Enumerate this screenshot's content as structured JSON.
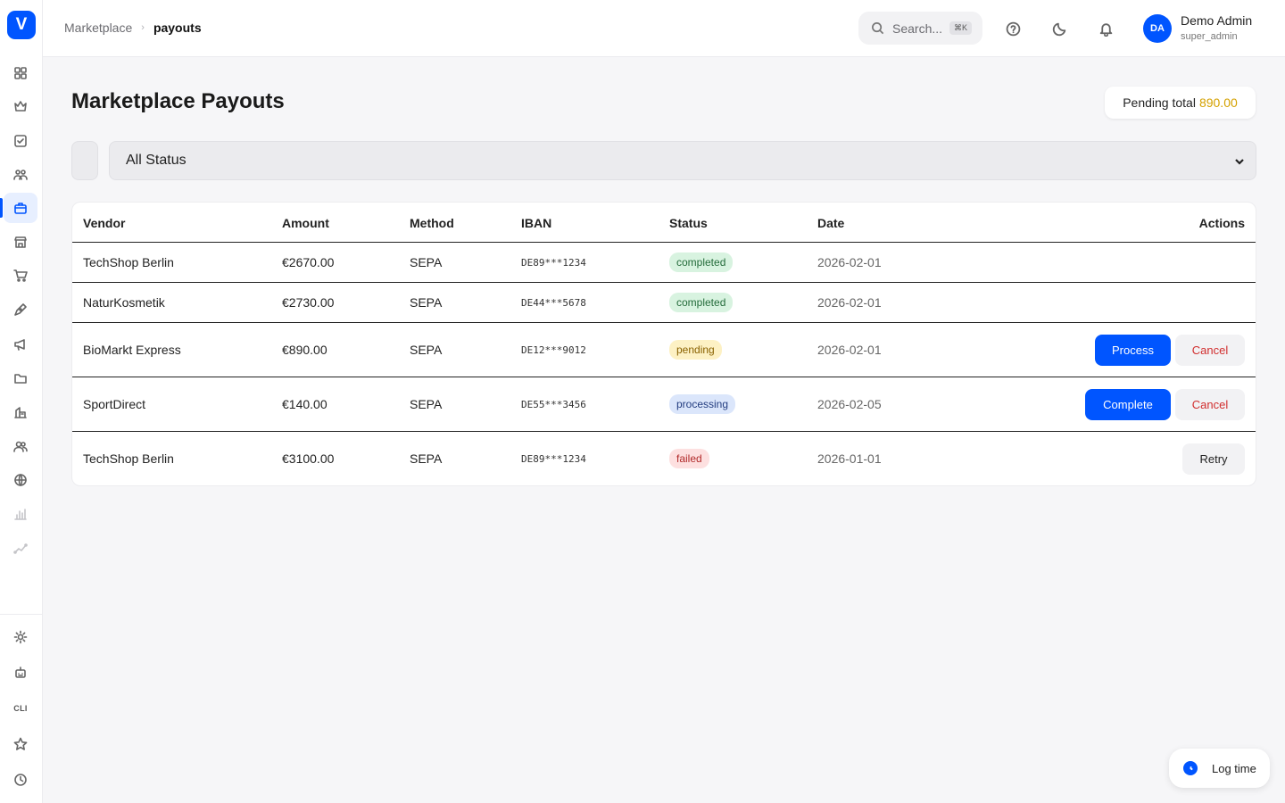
{
  "app": {
    "logo_letter": "V",
    "accent_color": "#0055ff"
  },
  "sidebar": {
    "items": [
      {
        "name": "dashboard",
        "icon": "grid-icon"
      },
      {
        "name": "crown",
        "icon": "crown-icon"
      },
      {
        "name": "tasks",
        "icon": "checkbox-icon"
      },
      {
        "name": "team",
        "icon": "users-icon"
      },
      {
        "name": "marketplace",
        "icon": "briefcase-icon",
        "active": true
      },
      {
        "name": "store",
        "icon": "store-icon"
      },
      {
        "name": "cart",
        "icon": "cart-icon"
      },
      {
        "name": "design",
        "icon": "pen-icon"
      },
      {
        "name": "campaigns",
        "icon": "megaphone-icon"
      },
      {
        "name": "files",
        "icon": "folder-icon"
      },
      {
        "name": "buildings",
        "icon": "building-icon"
      },
      {
        "name": "contacts",
        "icon": "people-icon"
      },
      {
        "name": "globe",
        "icon": "globe-icon"
      },
      {
        "name": "analytics",
        "icon": "bar-chart-icon"
      },
      {
        "name": "trends",
        "icon": "trend-icon"
      }
    ],
    "bottom_items": [
      {
        "name": "settings",
        "icon": "gear-icon"
      },
      {
        "name": "bot",
        "icon": "robot-icon"
      },
      {
        "name": "cli",
        "label": "CLI"
      },
      {
        "name": "favorites",
        "icon": "star-icon"
      },
      {
        "name": "history",
        "icon": "clock-icon"
      }
    ]
  },
  "header": {
    "breadcrumb": {
      "parent": "Marketplace",
      "current": "payouts"
    },
    "search": {
      "placeholder": "Search...",
      "shortcut": "⌘K"
    },
    "user": {
      "initials": "DA",
      "name": "Demo Admin",
      "role": "super_admin"
    }
  },
  "page": {
    "title": "Marketplace Payouts",
    "pending_label": "Pending total",
    "pending_value": "890.00",
    "status_filter": "All Status"
  },
  "table": {
    "columns": [
      "Vendor",
      "Amount",
      "Method",
      "IBAN",
      "Status",
      "Date",
      "Actions"
    ],
    "rows": [
      {
        "vendor": "TechShop Berlin",
        "amount": "€2670.00",
        "method": "SEPA",
        "iban": "DE89***1234",
        "status": "completed",
        "date": "2026-02-01",
        "actions": []
      },
      {
        "vendor": "NaturKosmetik",
        "amount": "€2730.00",
        "method": "SEPA",
        "iban": "DE44***5678",
        "status": "completed",
        "date": "2026-02-01",
        "actions": []
      },
      {
        "vendor": "BioMarkt Express",
        "amount": "€890.00",
        "method": "SEPA",
        "iban": "DE12***9012",
        "status": "pending",
        "date": "2026-02-01",
        "actions": [
          "Process",
          "Cancel"
        ]
      },
      {
        "vendor": "SportDirect",
        "amount": "€140.00",
        "method": "SEPA",
        "iban": "DE55***3456",
        "status": "processing",
        "date": "2026-02-05",
        "actions": [
          "Complete",
          "Cancel"
        ]
      },
      {
        "vendor": "TechShop Berlin",
        "amount": "€3100.00",
        "method": "SEPA",
        "iban": "DE89***1234",
        "status": "failed",
        "date": "2026-01-01",
        "actions": [
          "Retry"
        ]
      }
    ]
  },
  "floating": {
    "log_time_label": "Log time"
  }
}
